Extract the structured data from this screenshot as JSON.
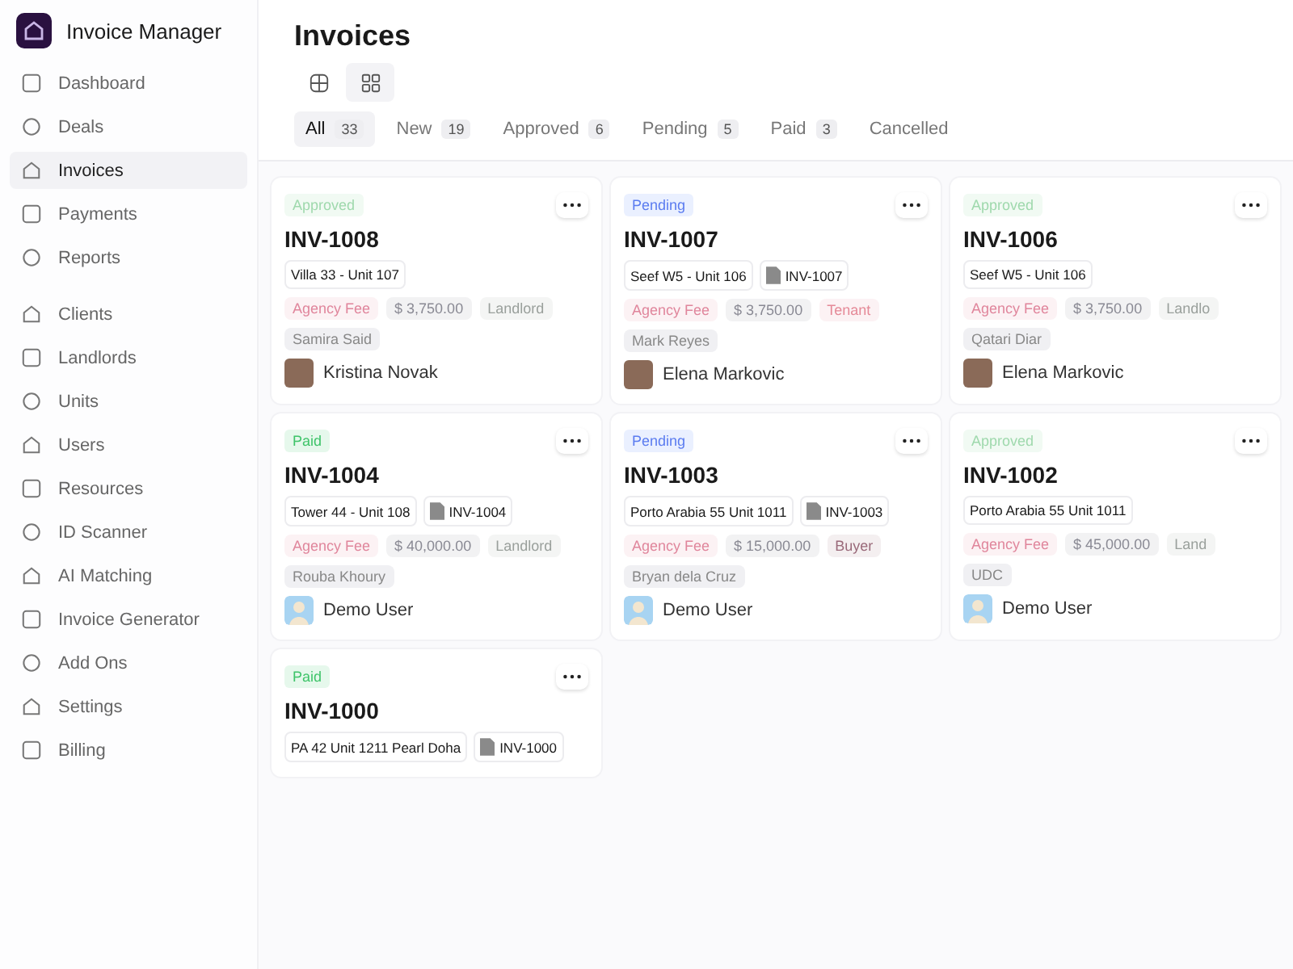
{
  "app": {
    "title": "Invoice Manager"
  },
  "sidebar": {
    "groups": [
      {
        "items": [
          {
            "label": "Dashboard",
            "selected": false
          },
          {
            "label": "Deals",
            "selected": false
          },
          {
            "label": "Invoices",
            "selected": true
          },
          {
            "label": "Payments",
            "selected": false
          },
          {
            "label": "Reports",
            "selected": false
          }
        ]
      },
      {
        "items": [
          {
            "label": "Clients",
            "selected": false
          },
          {
            "label": "Landlords",
            "selected": false
          },
          {
            "label": "Units",
            "selected": false
          },
          {
            "label": "Users",
            "selected": false
          },
          {
            "label": "Resources",
            "selected": false
          },
          {
            "label": "ID Scanner",
            "selected": false
          },
          {
            "label": "AI Matching",
            "selected": false
          },
          {
            "label": "Invoice Generator",
            "selected": false
          },
          {
            "label": "Add Ons",
            "selected": false
          },
          {
            "label": "Settings",
            "selected": false
          },
          {
            "label": "Billing",
            "selected": false
          }
        ]
      }
    ]
  },
  "page": {
    "title": "Invoices"
  },
  "view_toggle": [
    {
      "kind": "table",
      "selected": false
    },
    {
      "kind": "grid",
      "selected": true
    }
  ],
  "tabs": [
    {
      "label": "All",
      "count": "33",
      "selected": true
    },
    {
      "label": "New",
      "count": "19",
      "selected": false
    },
    {
      "label": "Approved",
      "count": "6",
      "selected": false
    },
    {
      "label": "Pending",
      "count": "5",
      "selected": false
    },
    {
      "label": "Paid",
      "count": "3",
      "selected": false
    },
    {
      "label": "Cancelled",
      "selected": false
    }
  ],
  "cards": [
    {
      "status": {
        "label": "Approved",
        "kind": "approved"
      },
      "number": "INV-1008",
      "unit": "Villa 33 - Unit 107",
      "tags": [
        {
          "label": "Agency Fee",
          "color": "#e0869c"
        },
        {
          "label": "$ 3,750.00",
          "color": "#8a8a94"
        },
        {
          "label": "Landlord",
          "color": "#9aa09c"
        }
      ],
      "contact": "Samira Said",
      "user": {
        "name": "Kristina Novak",
        "kind": "photo"
      }
    },
    {
      "status": {
        "label": "Pending",
        "kind": "pending"
      },
      "number": "INV-1007",
      "unit": "Seef W5 - Unit 106",
      "file": "INV-1007",
      "tags": [
        {
          "label": "Agency Fee",
          "color": "#e0869c"
        },
        {
          "label": "$ 3,750.00",
          "color": "#8a8a94"
        },
        {
          "label": "Tenant",
          "color": "#e58a98"
        }
      ],
      "contact": "Mark Reyes",
      "user": {
        "name": "Elena Markovic",
        "kind": "photo"
      }
    },
    {
      "status": {
        "label": "Approved",
        "kind": "approved"
      },
      "number": "INV-1006",
      "unit": "Seef W5 - Unit 106",
      "tags": [
        {
          "label": "Agency Fee",
          "color": "#e0869c"
        },
        {
          "label": "$ 3,750.00",
          "color": "#8a8a94"
        },
        {
          "label": "Landlo",
          "color": "#9aa09c"
        }
      ],
      "contact": "Qatari Diar",
      "user": {
        "name": "Elena Markovic",
        "kind": "photo"
      }
    },
    {
      "status": {
        "label": "Paid",
        "kind": "paid"
      },
      "number": "INV-1004",
      "unit": "Tower 44 - Unit 108",
      "file": "INV-1004",
      "tags": [
        {
          "label": "Agency Fee",
          "color": "#e0869c"
        },
        {
          "label": "$ 40,000.00",
          "color": "#8a8a94"
        },
        {
          "label": "Landlord",
          "color": "#9aa09c"
        }
      ],
      "contact": "Rouba Khoury",
      "user": {
        "name": "Demo User",
        "kind": "illustration"
      }
    },
    {
      "status": {
        "label": "Pending",
        "kind": "pending"
      },
      "number": "INV-1003",
      "unit": "Porto Arabia 55 Unit 1011",
      "file": "INV-1003",
      "tags": [
        {
          "label": "Agency Fee",
          "color": "#e0869c"
        },
        {
          "label": "$ 15,000.00",
          "color": "#8a8a94"
        },
        {
          "label": "Buyer",
          "color": "#9a6a7a"
        }
      ],
      "contact": "Bryan dela Cruz",
      "user": {
        "name": "Demo User",
        "kind": "illustration"
      }
    },
    {
      "status": {
        "label": "Approved",
        "kind": "approved"
      },
      "number": "INV-1002",
      "unit": "Porto Arabia 55 Unit 1011",
      "tags": [
        {
          "label": "Agency Fee",
          "color": "#e0869c"
        },
        {
          "label": "$ 45,000.00",
          "color": "#8a8a94"
        },
        {
          "label": "Land",
          "color": "#9aa09c"
        }
      ],
      "contact": "UDC",
      "user": {
        "name": "Demo User",
        "kind": "illustration"
      }
    },
    {
      "status": {
        "label": "Paid",
        "kind": "paid"
      },
      "number": "INV-1000",
      "unit": "PA 42 Unit 1211 Pearl Doha",
      "file": "INV-1000"
    }
  ]
}
